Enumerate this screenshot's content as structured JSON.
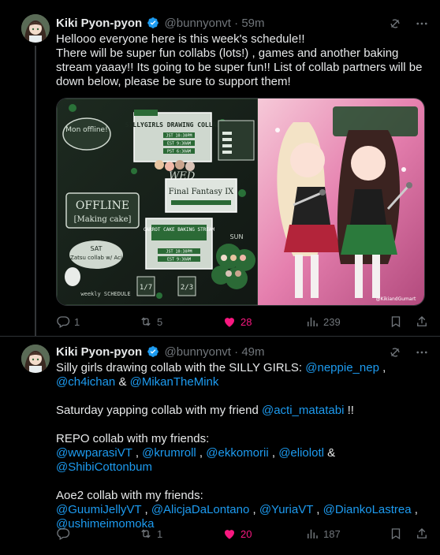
{
  "tweets": [
    {
      "author": {
        "name": "Kiki Pyon-pyon",
        "handle": "@bunnyonvt",
        "time": "59m"
      },
      "text": "Hellooo everyone here is this week's schedule!!\nThere will be super fun collabs (lots!) , games and another baking stream yaaay!! Its going to be super fun!! List of collab partners will be down below, please be sure to support them!",
      "media": {
        "left_panel": {
          "offline_label": "Mon offline!",
          "schedule_card_1": {
            "title": "SILLYGIRLS DRAWING COLLAB",
            "slots": [
              "JST 10:30PM",
              "EST 9:30AM",
              "PST 6:30AM"
            ]
          },
          "offline_card": {
            "title": "OFFLINE",
            "subtitle": "[Making cake]"
          },
          "wed_label": "WED",
          "game_card": {
            "title": "Final Fantasy IX"
          },
          "baking_card": {
            "title": "CARROT CAKE BAKING STREAM",
            "slots": [
              "JST 10:30PM",
              "EST 9:30AM"
            ]
          },
          "sat_label": "SAT",
          "sat_text": "Zatsu collab w/ Aci",
          "sun_label": "SUN",
          "week_label": "weekly SCHEDULE",
          "date_1": "1/7",
          "date_2": "2/3"
        },
        "right_panel": {
          "corner_text": "@KikiandGumart"
        }
      },
      "stats": {
        "replies": "1",
        "reposts": "5",
        "likes": "28",
        "views": "239"
      }
    },
    {
      "author": {
        "name": "Kiki Pyon-pyon",
        "handle": "@bunnyonvt",
        "time": "49m"
      },
      "lines": [
        {
          "segments": [
            {
              "t": "Silly girls drawing collab with the SILLY GIRLS: ",
              "m": false
            },
            {
              "t": "@neppie_nep",
              "m": true
            },
            {
              "t": " , ",
              "m": false
            },
            {
              "t": "@ch4ichan",
              "m": true
            },
            {
              "t": " & ",
              "m": false
            },
            {
              "t": "@MikanTheMink",
              "m": true
            }
          ]
        },
        {
          "segments": []
        },
        {
          "segments": [
            {
              "t": "Saturday yapping collab with my friend ",
              "m": false
            },
            {
              "t": "@acti_matatabi",
              "m": true
            },
            {
              "t": " !!",
              "m": false
            }
          ]
        },
        {
          "segments": []
        },
        {
          "segments": [
            {
              "t": "REPO collab with my friends:",
              "m": false
            }
          ]
        },
        {
          "segments": [
            {
              "t": "@wwparasiVT",
              "m": true
            },
            {
              "t": " , ",
              "m": false
            },
            {
              "t": "@krumroll",
              "m": true
            },
            {
              "t": " , ",
              "m": false
            },
            {
              "t": "@ekkomorii",
              "m": true
            },
            {
              "t": " , ",
              "m": false
            },
            {
              "t": "@eliolotl",
              "m": true
            },
            {
              "t": " & ",
              "m": false
            },
            {
              "t": "@ShibiCottonbum",
              "m": true
            }
          ]
        },
        {
          "segments": []
        },
        {
          "segments": [
            {
              "t": "Aoe2 collab with my friends:",
              "m": false
            }
          ]
        },
        {
          "segments": [
            {
              "t": "@GuumiJellyVT",
              "m": true
            },
            {
              "t": " , ",
              "m": false
            },
            {
              "t": "@AlicjaDaLontano",
              "m": true
            },
            {
              "t": " , ",
              "m": false
            },
            {
              "t": "@YuriaVT",
              "m": true
            },
            {
              "t": " , ",
              "m": false
            },
            {
              "t": "@DiankoLastrea",
              "m": true
            },
            {
              "t": " , ",
              "m": false
            },
            {
              "t": "@ushimeimomoka",
              "m": true
            }
          ]
        }
      ],
      "stats": {
        "replies": "",
        "reposts": "1",
        "likes": "20",
        "views": "187"
      }
    }
  ],
  "colors": {
    "background": "#000000",
    "text": "#e7e9ea",
    "muted": "#71767b",
    "link": "#1d9bf0",
    "like": "#f91880",
    "verified": "#1d9bf0",
    "divider": "#2f3336"
  },
  "icons": [
    "verified-badge-icon",
    "grok-icon",
    "more-icon",
    "reply-icon",
    "repost-icon",
    "like-icon",
    "views-icon",
    "bookmark-icon",
    "share-icon"
  ]
}
